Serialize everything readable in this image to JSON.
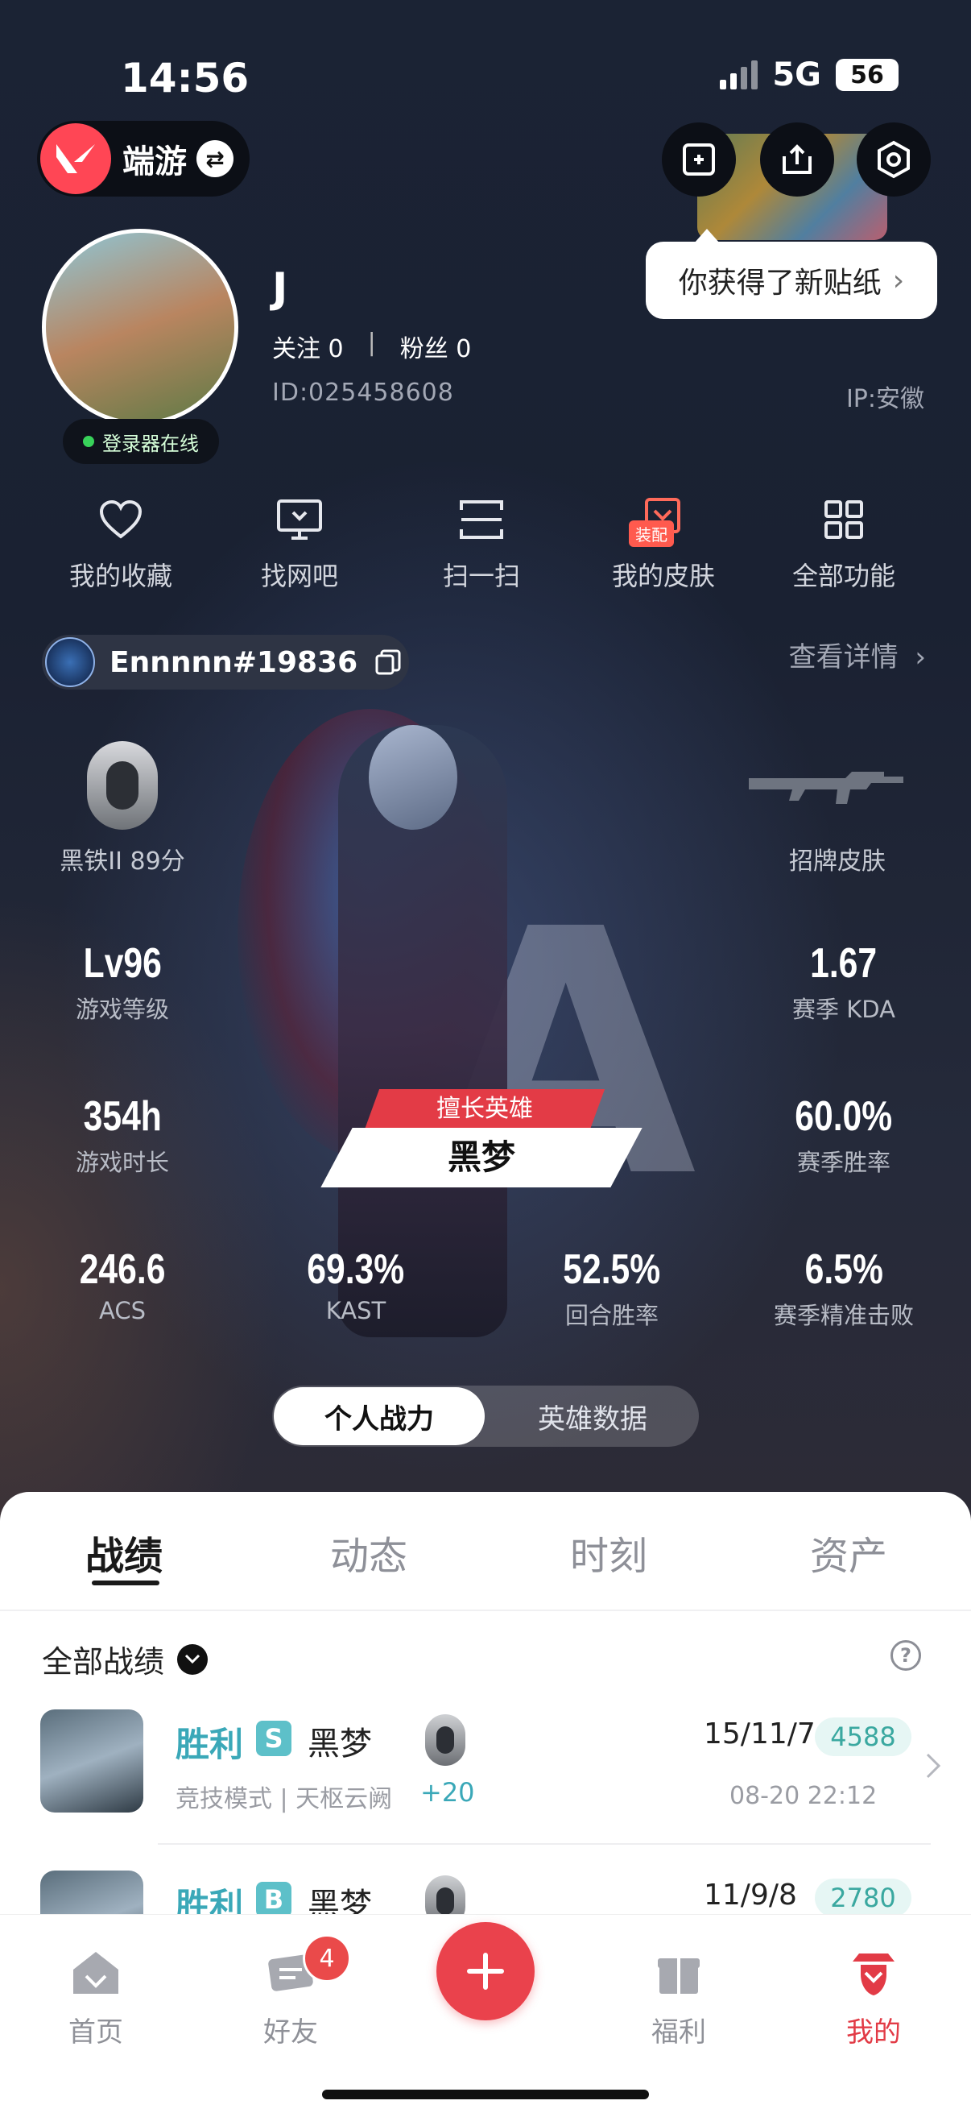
{
  "status": {
    "time": "14:56",
    "network": "5G",
    "battery": "56"
  },
  "header": {
    "brand": "端游",
    "sticker_tip": "你获得了新贴纸"
  },
  "profile": {
    "name": "J",
    "follow_label": "关注 0",
    "fans_label": "粉丝 0",
    "id": "ID:025458608",
    "ip": "IP:安徽",
    "online": "登录器在线"
  },
  "quick_actions": [
    {
      "label": "我的收藏",
      "icon": "heart-icon"
    },
    {
      "label": "找网吧",
      "icon": "monitor-icon"
    },
    {
      "label": "扫一扫",
      "icon": "scan-icon"
    },
    {
      "label": "我的皮肤",
      "icon": "skin-icon",
      "badge": "装配"
    },
    {
      "label": "全部功能",
      "icon": "grid-icon"
    }
  ],
  "game_account": {
    "tag": "Ennnnn#19836",
    "details": "查看详情"
  },
  "rank": {
    "label": "黑铁II 89分"
  },
  "showcase_skin": {
    "label": "招牌皮肤"
  },
  "stats": {
    "level": {
      "value": "Lv96",
      "label": "游戏等级"
    },
    "kda": {
      "value": "1.67",
      "label": "赛季 KDA"
    },
    "hours": {
      "value": "354h",
      "label": "游戏时长"
    },
    "winrate": {
      "value": "60.0%",
      "label": "赛季胜率"
    },
    "acs": {
      "value": "246.6",
      "label": "ACS"
    },
    "kast": {
      "value": "69.3%",
      "label": "KAST"
    },
    "round_win": {
      "value": "52.5%",
      "label": "回合胜率"
    },
    "precision": {
      "value": "6.5%",
      "label": "赛季精准击败"
    }
  },
  "best_agent": {
    "badge": "擅长英雄",
    "name": "黑梦"
  },
  "toggle": {
    "active": "个人战力",
    "inactive": "英雄数据"
  },
  "tabs": [
    "战绩",
    "动态",
    "时刻",
    "资产"
  ],
  "filter": {
    "label": "全部战绩"
  },
  "matches": [
    {
      "result": "胜利",
      "grade": "S",
      "agent": "黑梦",
      "mode": "竞技模式 | 天枢云阙",
      "delta": "+20",
      "score": "15/11/7",
      "acs": "4588",
      "time": "08-20 22:12"
    },
    {
      "result": "胜利",
      "grade": "B",
      "agent": "黑梦",
      "mode": "",
      "delta": "",
      "score": "11/9/8",
      "acs": "2780",
      "time": ""
    }
  ],
  "nav": {
    "home": "首页",
    "friends": "好友",
    "friends_badge": "4",
    "welfare": "福利",
    "mine": "我的"
  },
  "colors": {
    "accent": "#ea424c",
    "win": "#3aa8b8"
  }
}
